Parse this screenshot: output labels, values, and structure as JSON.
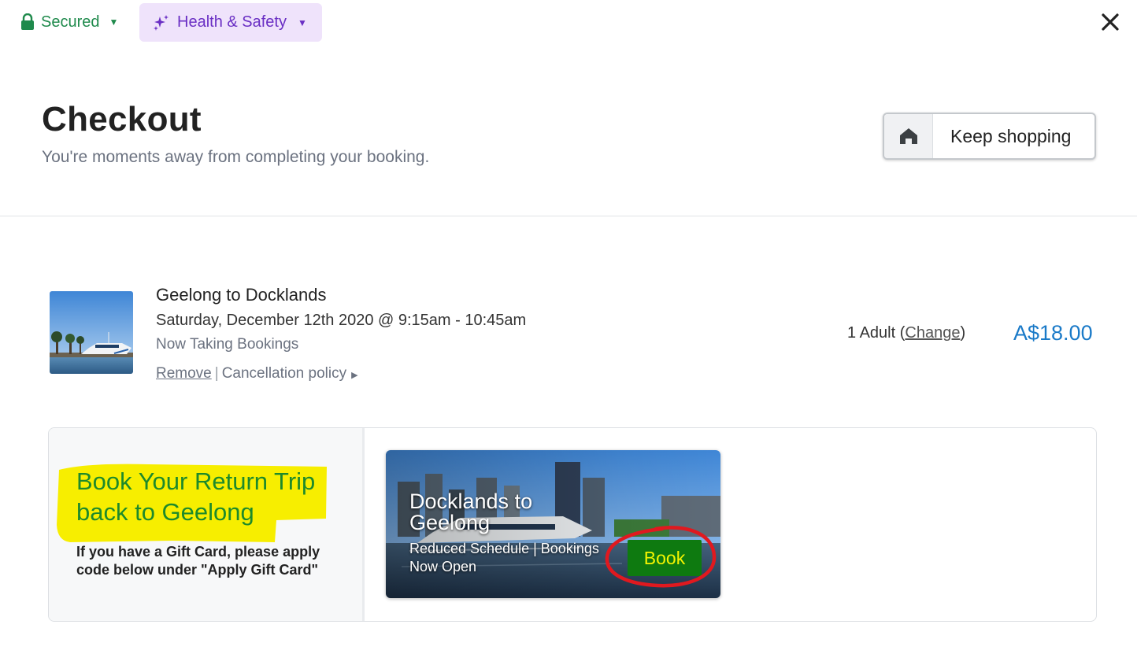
{
  "topbar": {
    "secured_label": "Secured",
    "health_label": "Health & Safety",
    "icons": [
      "lock-icon",
      "sparkle-icon",
      "caret-down-icon",
      "close-icon"
    ]
  },
  "header": {
    "title": "Checkout",
    "subtitle": "You're moments away from completing your booking.",
    "keep_shopping_label": "Keep shopping"
  },
  "booking": {
    "title": "Geelong to Docklands",
    "date": "Saturday, December 12th 2020 @ 9:15am - 10:45am",
    "status": "Now Taking Bookings",
    "remove_label": "Remove",
    "separator": "|",
    "cancellation_label": "Cancellation policy",
    "qty_prefix": "1 Adult (",
    "change_label": "Change",
    "qty_suffix": ")",
    "price": "A$18.00"
  },
  "promo": {
    "heading": "Book Your Return Trip back to Geelong",
    "note": "If you have a Gift Card, please apply code below under \"Apply Gift Card\"",
    "card": {
      "title": "Docklands to Geelong",
      "subtitle": "Reduced Schedule | Bookings Now Open",
      "book_label": "Book"
    }
  },
  "colors": {
    "secured_green": "#1f8a4c",
    "health_purple": "#6a2fc4",
    "health_bg": "#efe3fb",
    "price_blue": "#1a7ac8",
    "promo_green": "#1d8a2b",
    "highlight_yellow": "#f7ee00",
    "book_bg": "#0e7a10",
    "book_text": "#f5f500",
    "annotation_red": "#e0191f"
  }
}
